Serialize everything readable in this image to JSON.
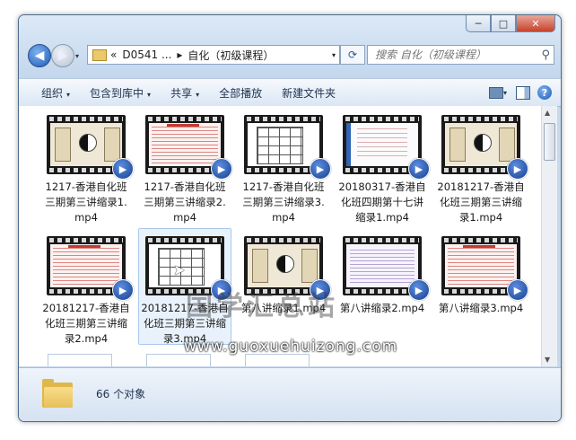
{
  "window": {
    "buttons": {
      "minimize": "─",
      "maximize": "□",
      "close": "✕"
    }
  },
  "nav": {
    "back_glyph": "◀",
    "forward_glyph": "▶",
    "dropdown_glyph": "▾",
    "breadcrumb": [
      "«",
      "D0541 ...",
      "▸",
      "自化（初级课程）",
      "▸"
    ],
    "refresh_glyph": "⟳",
    "search_placeholder": "搜索 自化（初级课程）",
    "search_icon": "search-icon"
  },
  "toolbar": {
    "items": [
      {
        "label": "组织",
        "dropdown": true
      },
      {
        "label": "包含到库中",
        "dropdown": true
      },
      {
        "label": "共享",
        "dropdown": true
      },
      {
        "label": "全部播放",
        "dropdown": false
      },
      {
        "label": "新建文件夹",
        "dropdown": false
      }
    ],
    "dropdown_glyph": "▾",
    "help_glyph": "?"
  },
  "files": [
    {
      "name": "1217-香港自化班三期第三讲缩录1.mp4",
      "thumb": "calligraphy"
    },
    {
      "name": "1217-香港自化班三期第三讲缩录2.mp4",
      "thumb": "redtext"
    },
    {
      "name": "1217-香港自化班三期第三讲缩录3.mp4",
      "thumb": "table"
    },
    {
      "name": "20180317-香港自化班四期第十七讲缩录1.mp4",
      "thumb": "doc"
    },
    {
      "name": "20181217-香港自化班三期第三讲缩录1.mp4",
      "thumb": "calligraphy"
    },
    {
      "name": "20181217-香港自化班三期第三讲缩录2.mp4",
      "thumb": "redtext"
    },
    {
      "name": "20181217-香港自化班三期第三讲缩录3.mp4",
      "thumb": "table",
      "selected": true
    },
    {
      "name": "第八讲缩录1.mp4",
      "thumb": "calligraphy"
    },
    {
      "name": "第八讲缩录2.mp4",
      "thumb": "doc2"
    },
    {
      "name": "第八讲缩录3.mp4",
      "thumb": "redtext"
    }
  ],
  "badge_glyph": "▶",
  "watermark": {
    "text": "国学汇总站",
    "url": "www.guoxuehuizong.com"
  },
  "details": {
    "count_text": "66 个对象"
  },
  "colors": {
    "selection": "#e9f2fc",
    "badge": "#1d4fa3",
    "toolbar_text": "#1e3250"
  }
}
